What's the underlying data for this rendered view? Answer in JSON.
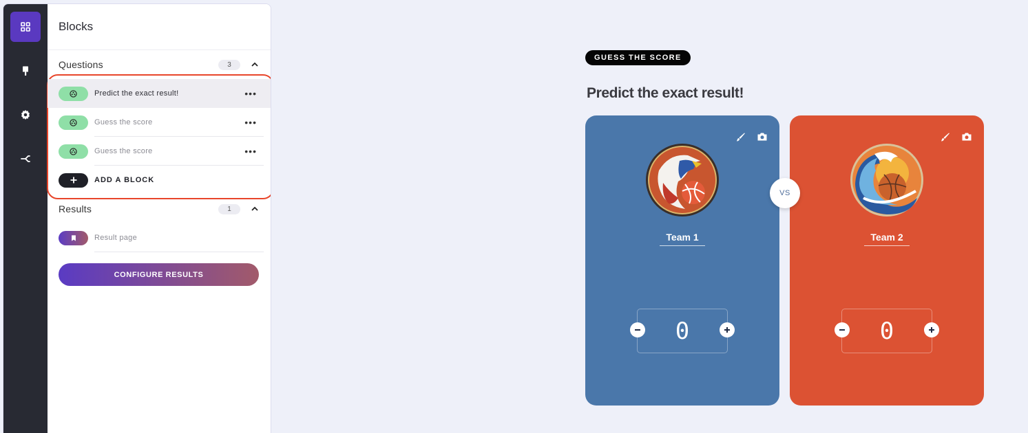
{
  "rail": {
    "items": [
      {
        "name": "blocks",
        "icon": "grid-icon",
        "active": true
      },
      {
        "name": "design",
        "icon": "paint-brush-icon",
        "active": false
      },
      {
        "name": "settings",
        "icon": "gear-icon",
        "active": false
      },
      {
        "name": "share",
        "icon": "share-icon",
        "active": false
      }
    ]
  },
  "panel": {
    "title": "Blocks",
    "questions": {
      "title": "Questions",
      "count": "3",
      "items": [
        {
          "label": "Predict the exact result!",
          "icon": "soccer-ball-icon",
          "selected": true
        },
        {
          "label": "Guess the score",
          "icon": "soccer-ball-icon",
          "selected": false
        },
        {
          "label": "Guess the score",
          "icon": "soccer-ball-icon",
          "selected": false
        }
      ],
      "add_label": "ADD A BLOCK"
    },
    "results": {
      "title": "Results",
      "count": "1",
      "items": [
        {
          "label": "Result page",
          "icon": "bookmark-icon"
        }
      ],
      "configure_label": "CONFIGURE RESULTS"
    }
  },
  "preview": {
    "tag": "GUESS THE SCORE",
    "headline": "Predict the exact result!",
    "vs_label": "VS",
    "teams": [
      {
        "name": "Team 1",
        "score": "0",
        "color": "#4a77aa",
        "logo": "eagle-basketball-logo"
      },
      {
        "name": "Team 2",
        "score": "0",
        "color": "#dc5233",
        "logo": "wave-basketball-logo"
      }
    ]
  },
  "colors": {
    "accent": "#5a39c0",
    "highlight": "#e8452a",
    "question_pill": "#8fdfa7"
  }
}
